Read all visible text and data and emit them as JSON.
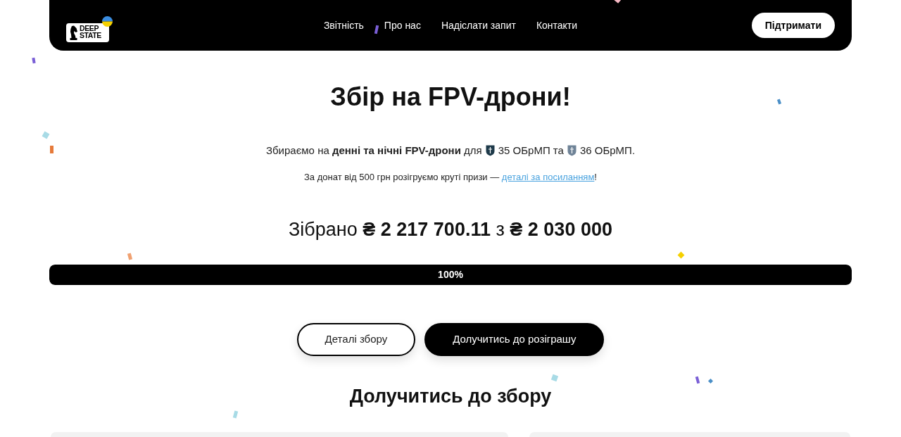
{
  "nav": {
    "logo": {
      "lines": [
        "DEEP",
        "STATE"
      ]
    },
    "links": [
      {
        "label": "Звітність"
      },
      {
        "label": "Про нас"
      },
      {
        "label": "Надіслати запит"
      },
      {
        "label": "Контакти"
      }
    ],
    "action": "Підтримати"
  },
  "campaign": {
    "title": "Збір на FPV-дрони!",
    "purpose": [
      {
        "kind": "text",
        "text": "Збираємо на **денні та нічні FPV-дрони** для"
      },
      {
        "kind": "emblem",
        "color": "#1e3a4a"
      },
      {
        "kind": "text",
        "text": "35 ОБрМП та"
      },
      {
        "kind": "emblem",
        "color": "#6f8397"
      },
      {
        "kind": "text",
        "text": "36 ОБрМП."
      }
    ],
    "raffle": {
      "before": "За донат від 500 грн розігруємо круті призи —",
      "link": "деталі за посиланням",
      "after": "!"
    },
    "total": "Зібрано **₴ 2 217 700.11** з **₴ 2 030 000**",
    "progress": {
      "level": 1,
      "label": "100%"
    },
    "buttons": [
      {
        "label": "Деталі збору",
        "kind": "outline"
      },
      {
        "label": "Долучитись до розіграшу",
        "kind": "solid"
      }
    ]
  },
  "join": {
    "title": "Долучитись до збору"
  }
}
